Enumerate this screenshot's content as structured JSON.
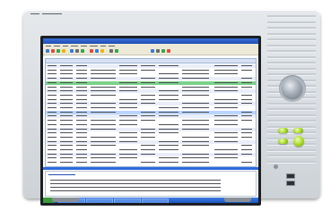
{
  "image": {
    "subject": "logic-analyzer-instrument",
    "software": {
      "listing_rows": 24,
      "highlighted_row": 4
    },
    "front_panel": {
      "knob": "rotary-knob",
      "button_color": "#9fd31c",
      "usb_ports": 2
    }
  }
}
